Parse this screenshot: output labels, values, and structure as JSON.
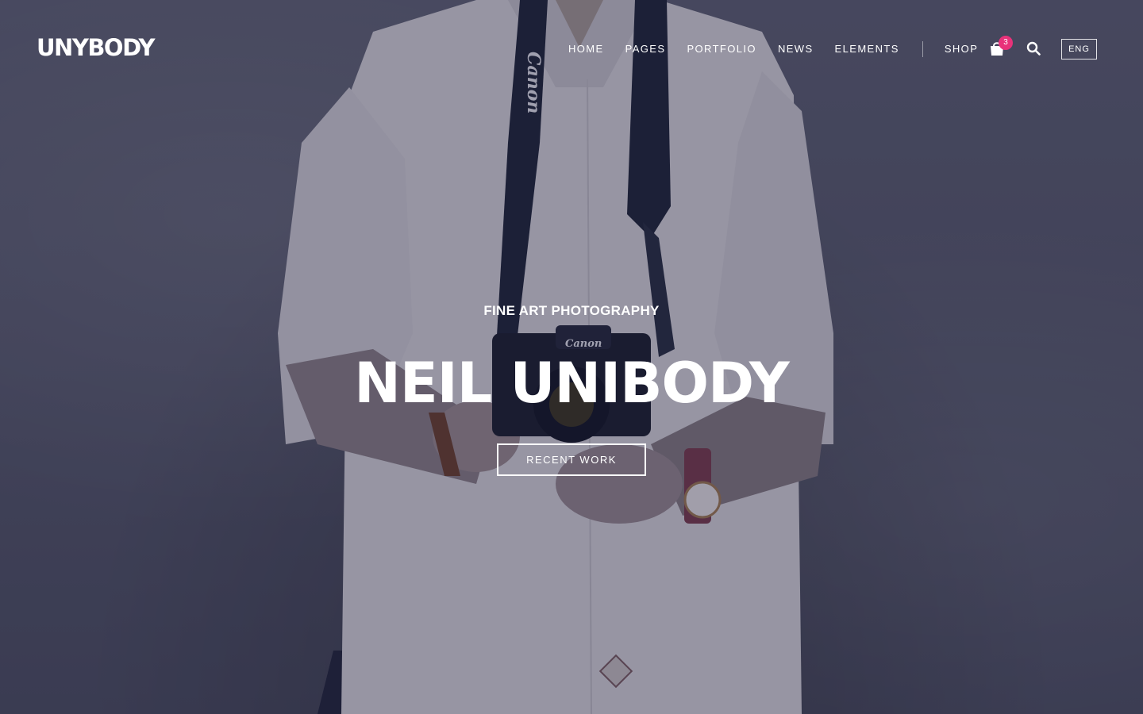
{
  "brand": {
    "logo_text": "UNYBODY"
  },
  "nav": {
    "items": [
      {
        "label": "HOME"
      },
      {
        "label": "PAGES"
      },
      {
        "label": "PORTFOLIO"
      },
      {
        "label": "NEWS"
      },
      {
        "label": "ELEMENTS"
      }
    ],
    "shop_label": "SHOP",
    "cart_count": "3",
    "cart_icon": "shopping-bag-icon",
    "search_icon": "search-icon",
    "language": "ENG"
  },
  "hero": {
    "subtitle": "FINE ART PHOTOGRAPHY",
    "title": "NEIL UNIBODY",
    "cta_label": "RECENT WORK",
    "strap_brand": "Canon",
    "camera_brand": "Canon"
  },
  "colors": {
    "overlay": "#1c1e3a",
    "badge": "#e8327a",
    "text": "#ffffff"
  }
}
